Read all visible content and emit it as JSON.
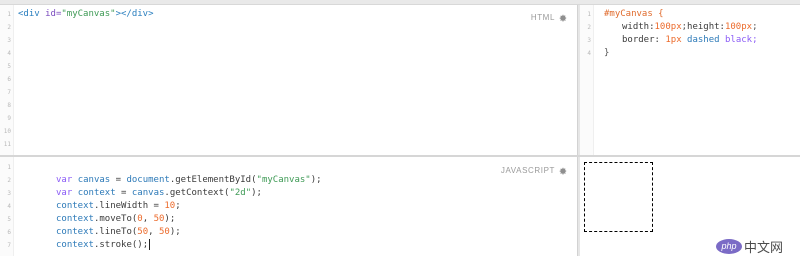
{
  "html_pane": {
    "label": "HTML",
    "line_numbers": [
      "1",
      "2",
      "3",
      "4",
      "5",
      "6",
      "7",
      "8",
      "9",
      "10",
      "11"
    ],
    "code": {
      "open_tag": "<div",
      "attr_name": " id=",
      "attr_value": "\"myCanvas\"",
      "close": "></div>"
    }
  },
  "css_pane": {
    "line_numbers": [
      "1",
      "2",
      "3",
      "4"
    ],
    "selector": "#myCanvas {",
    "line2": {
      "prop1": "width:",
      "val1": "100px",
      "sep": ";",
      "prop2": "height:",
      "val2": "100px",
      "end": ";"
    },
    "line3": {
      "prop": "border: ",
      "num": "1px",
      "kw": " dashed",
      "rest": " black;"
    },
    "close_brace": "}"
  },
  "js_pane": {
    "label": "JAVASCRIPT",
    "line_numbers": [
      "1",
      "2",
      "3",
      "4",
      "5",
      "6",
      "7"
    ],
    "lines": [
      {
        "kw": "var ",
        "name": "canvas",
        "rest_a": " = ",
        "obj": "document",
        "rest_b": ".getElementById(",
        "str": "\"myCanvas\"",
        "end": ");"
      },
      {
        "kw": "var ",
        "name": "context",
        "rest_a": " = ",
        "obj": "canvas",
        "rest_b": ".getContext(",
        "str": "\"2d\"",
        "end": ");"
      },
      {
        "obj": "context",
        "rest": ".lineWidth = ",
        "num": "10",
        "end": ";"
      },
      {
        "obj": "context",
        "rest": ".moveTo(",
        "num": "0",
        "sep": ", ",
        "num2": "50",
        "end": ");"
      },
      {
        "obj": "context",
        "rest": ".lineTo(",
        "num": "50",
        "sep": ", ",
        "num2": "50",
        "end": ");"
      },
      {
        "obj": "context",
        "rest": ".stroke();"
      }
    ]
  },
  "result_pane": {
    "canvas_border": "1px dashed black"
  },
  "watermark": {
    "logo": "php",
    "text": "中文网"
  },
  "colors": {
    "tag": "#2a7fbf",
    "string": "#3e9a55",
    "number": "#ec6b2c",
    "keyword": "#8b5cf6",
    "variable": "#2d7ab8",
    "selector": "#e06b2d",
    "label": "#9a9a9a"
  }
}
